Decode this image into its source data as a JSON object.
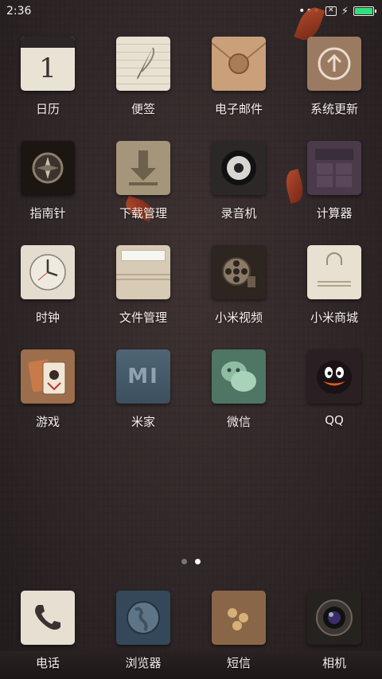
{
  "status_bar": {
    "time": "2:36",
    "more_glyph": "•••",
    "notification_glyph": "✕",
    "charging_glyph": "⚡",
    "battery_level": 1.0,
    "battery_color": "#2fe07d"
  },
  "apps": [
    {
      "label": "日历",
      "icon": "calendar-icon",
      "day": "1"
    },
    {
      "label": "便签",
      "icon": "notes-icon"
    },
    {
      "label": "电子邮件",
      "icon": "email-icon"
    },
    {
      "label": "系统更新",
      "icon": "system-update-icon"
    },
    {
      "label": "指南针",
      "icon": "compass-icon"
    },
    {
      "label": "下载管理",
      "icon": "download-icon"
    },
    {
      "label": "录音机",
      "icon": "recorder-icon"
    },
    {
      "label": "计算器",
      "icon": "calculator-icon"
    },
    {
      "label": "时钟",
      "icon": "clock-icon"
    },
    {
      "label": "文件管理",
      "icon": "file-manager-icon"
    },
    {
      "label": "小米视频",
      "icon": "video-icon"
    },
    {
      "label": "小米商城",
      "icon": "mi-store-icon"
    },
    {
      "label": "游戏",
      "icon": "game-icon"
    },
    {
      "label": "米家",
      "icon": "mijia-icon",
      "logo": "MI"
    },
    {
      "label": "微信",
      "icon": "wechat-icon"
    },
    {
      "label": "QQ",
      "icon": "qq-icon"
    }
  ],
  "pagination": {
    "pages": 2,
    "current": 2
  },
  "dock": [
    {
      "label": "电话",
      "icon": "phone-icon"
    },
    {
      "label": "浏览器",
      "icon": "browser-icon"
    },
    {
      "label": "短信",
      "icon": "messages-icon"
    },
    {
      "label": "相机",
      "icon": "camera-icon"
    }
  ]
}
